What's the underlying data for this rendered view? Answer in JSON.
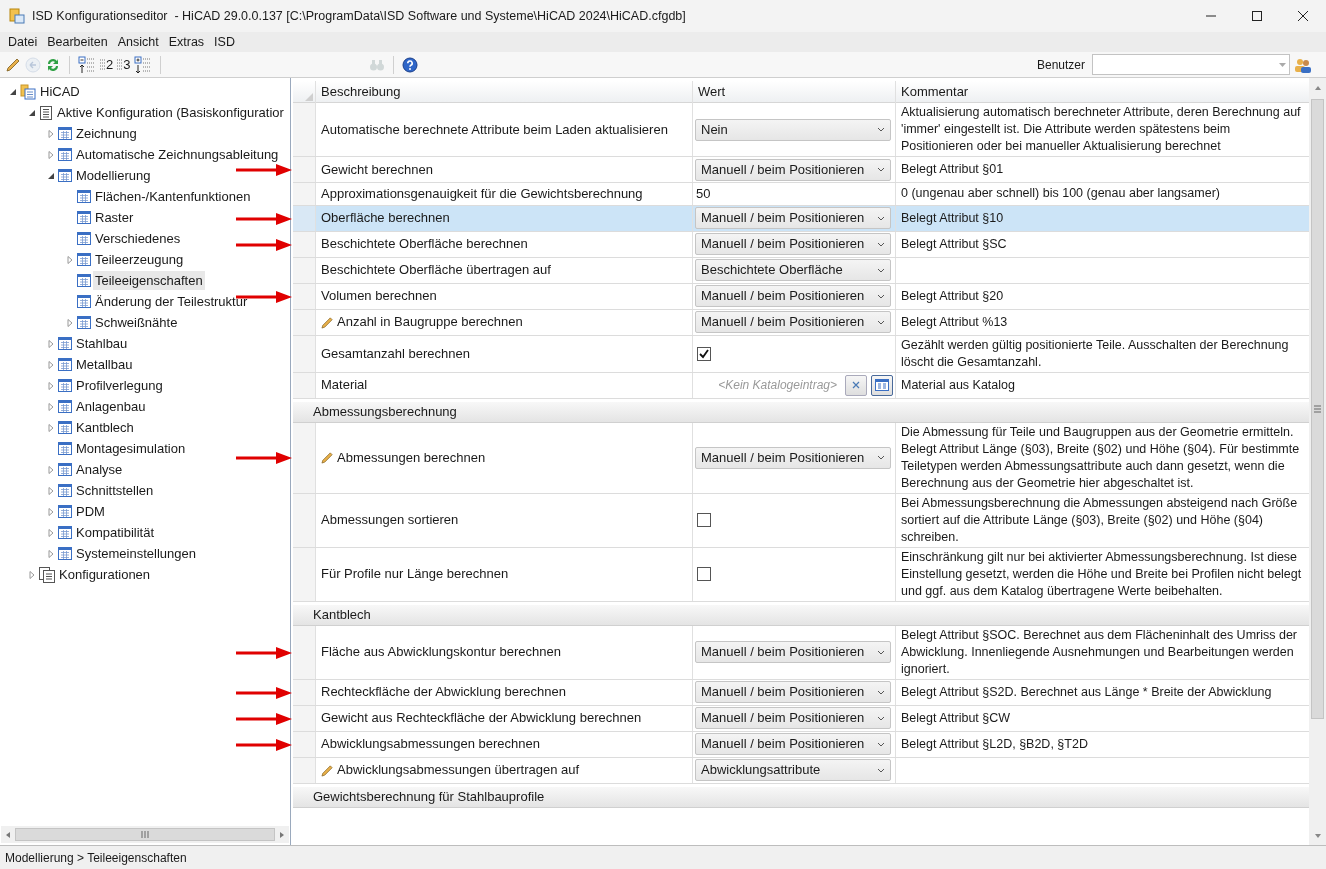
{
  "window": {
    "title": "ISD Konfigurationseditor  - HiCAD 29.0.0.137 [C:\\ProgramData\\ISD Software und Systeme\\HiCAD 2024\\HiCAD.cfgdb]"
  },
  "menu": [
    "Datei",
    "Bearbeiten",
    "Ansicht",
    "Extras",
    "ISD"
  ],
  "toolbar": [
    {
      "kind": "edit",
      "disabled": false
    },
    {
      "kind": "undo",
      "disabled": true
    },
    {
      "kind": "refresh",
      "disabled": false
    },
    {
      "kind": "sep"
    },
    {
      "kind": "level-collapse",
      "disabled": false
    },
    {
      "kind": "level",
      "label": "2",
      "disabled": false
    },
    {
      "kind": "level",
      "label": "3",
      "disabled": false
    },
    {
      "kind": "level-expand",
      "disabled": false
    },
    {
      "kind": "sep"
    },
    {
      "kind": "search",
      "disabled": true
    },
    {
      "kind": "sep"
    },
    {
      "kind": "help",
      "disabled": false
    }
  ],
  "user": {
    "label": "Benutzer"
  },
  "tree": [
    {
      "label": "HiCAD",
      "kind": "root",
      "expandable": true,
      "expanded": true,
      "selected": false,
      "children": [
        {
          "label": "Aktive Konfiguration (Basiskonfiguratior",
          "kind": "config",
          "expandable": true,
          "expanded": true,
          "selected": false,
          "children": [
            {
              "label": "Zeichnung",
              "kind": "section",
              "expandable": true,
              "expanded": false,
              "selected": false
            },
            {
              "label": "Automatische Zeichnungsableitung",
              "kind": "section",
              "expandable": true,
              "expanded": false,
              "selected": false
            },
            {
              "label": "Modellierung",
              "kind": "section",
              "expandable": true,
              "expanded": true,
              "selected": false,
              "children": [
                {
                  "label": "Flächen-/Kantenfunktionen",
                  "kind": "section",
                  "expandable": false,
                  "selected": false
                },
                {
                  "label": "Raster",
                  "kind": "section",
                  "expandable": false,
                  "selected": false
                },
                {
                  "label": "Verschiedenes",
                  "kind": "section",
                  "expandable": false,
                  "selected": false
                },
                {
                  "label": "Teileerzeugung",
                  "kind": "section",
                  "expandable": true,
                  "expanded": false,
                  "selected": false
                },
                {
                  "label": "Teileeigenschaften",
                  "kind": "section",
                  "expandable": false,
                  "selected": true
                },
                {
                  "label": "Änderung der Teilestruktur",
                  "kind": "section",
                  "expandable": false,
                  "selected": false
                },
                {
                  "label": "Schweißnähte",
                  "kind": "section",
                  "expandable": true,
                  "expanded": false,
                  "selected": false
                }
              ]
            },
            {
              "label": "Stahlbau",
              "kind": "section",
              "expandable": true,
              "expanded": false,
              "selected": false
            },
            {
              "label": "Metallbau",
              "kind": "section",
              "expandable": true,
              "expanded": false,
              "selected": false
            },
            {
              "label": "Profilverlegung",
              "kind": "section",
              "expandable": true,
              "expanded": false,
              "selected": false
            },
            {
              "label": "Anlagenbau",
              "kind": "section",
              "expandable": true,
              "expanded": false,
              "selected": false
            },
            {
              "label": "Kantblech",
              "kind": "section",
              "expandable": true,
              "expanded": false,
              "selected": false
            },
            {
              "label": "Montagesimulation",
              "kind": "section",
              "expandable": false,
              "selected": false
            },
            {
              "label": "Analyse",
              "kind": "section",
              "expandable": true,
              "expanded": false,
              "selected": false
            },
            {
              "label": "Schnittstellen",
              "kind": "section",
              "expandable": true,
              "expanded": false,
              "selected": false
            },
            {
              "label": "PDM",
              "kind": "section",
              "expandable": true,
              "expanded": false,
              "selected": false
            },
            {
              "label": "Kompatibilität",
              "kind": "section",
              "expandable": true,
              "expanded": false,
              "selected": false
            },
            {
              "label": "Systemeinstellungen",
              "kind": "section",
              "expandable": true,
              "expanded": false,
              "selected": false
            }
          ]
        },
        {
          "label": "Konfigurationen",
          "kind": "configs",
          "expandable": true,
          "expanded": false,
          "selected": false
        }
      ]
    }
  ],
  "grid": {
    "columns": [
      "Beschreibung",
      "Wert",
      "Kommentar"
    ],
    "rows": [
      {
        "kind": "dropdown",
        "description": "Automatische berechnete Attribute beim Laden aktualisieren",
        "value": "Nein",
        "comment": "Aktualisierung automatisch berechneter Attribute, deren Berechnung auf 'immer' eingestellt ist. Die Attribute werden spätestens beim Positionieren oder bei manueller Aktualisierung berechnet",
        "edited": false,
        "arrow": false,
        "selected": false
      },
      {
        "kind": "dropdown",
        "description": "Gewicht berechnen",
        "value": "Manuell / beim Positionieren",
        "comment": "Belegt Attribut §01",
        "edited": false,
        "arrow": true,
        "selected": false
      },
      {
        "kind": "text",
        "description": "Approximationsgenauigkeit für die Gewichtsberechnung",
        "value": "50",
        "comment": "0 (ungenau aber schnell) bis 100 (genau aber langsamer)",
        "edited": false,
        "arrow": false,
        "selected": false
      },
      {
        "kind": "dropdown",
        "description": "Oberfläche berechnen",
        "value": "Manuell / beim Positionieren",
        "comment": "Belegt Attribut §10",
        "edited": false,
        "arrow": true,
        "selected": true
      },
      {
        "kind": "dropdown",
        "description": "Beschichtete Oberfläche berechnen",
        "value": "Manuell / beim Positionieren",
        "comment": "Belegt Attribut §SC",
        "edited": false,
        "arrow": true,
        "selected": false
      },
      {
        "kind": "dropdown",
        "description": "Beschichtete Oberfläche übertragen auf",
        "value": "Beschichtete Oberfläche",
        "edited": false,
        "arrow": false,
        "selected": false
      },
      {
        "kind": "dropdown",
        "description": "Volumen berechnen",
        "value": "Manuell / beim Positionieren",
        "comment": "Belegt Attribut §20",
        "edited": false,
        "arrow": true,
        "selected": false
      },
      {
        "kind": "dropdown",
        "description": "Anzahl in Baugruppe berechnen",
        "value": "Manuell / beim Positionieren",
        "comment": "Belegt Attribut %13",
        "edited": true,
        "arrow": false,
        "selected": false
      },
      {
        "kind": "checkbox",
        "description": "Gesamtanzahl berechnen",
        "checked": true,
        "comment": "Gezählt werden gültig positionierte Teile. Ausschalten der Berechnung löscht die Gesamtanzahl.",
        "edited": false,
        "arrow": false,
        "selected": false
      },
      {
        "kind": "catalog",
        "description": "Material",
        "placeholder": "<Kein Katalogeintrag>",
        "comment": "Material aus Katalog",
        "edited": false,
        "arrow": false,
        "selected": false
      },
      {
        "kind": "section",
        "description": "Abmessungsberechnung"
      },
      {
        "kind": "dropdown",
        "description": "Abmessungen berechnen",
        "value": "Manuell / beim Positionieren",
        "comment": "Die Abmessung für Teile und Baugruppen aus der Geometrie ermitteln. Belegt Attribut Länge (§03), Breite (§02) und Höhe (§04). Für bestimmte Teiletypen werden Abmessungsattribute auch dann gesetzt, wenn die Berechnung aus der Geometrie hier abgeschaltet ist.",
        "edited": true,
        "arrow": true,
        "selected": false
      },
      {
        "kind": "checkbox",
        "description": "Abmessungen sortieren",
        "checked": false,
        "comment": "Bei Abmessungsberechnung die Abmessungen absteigend nach Größe sortiert auf die Attribute Länge (§03), Breite (§02) und Höhe (§04) schreiben.",
        "edited": false,
        "arrow": false,
        "selected": false
      },
      {
        "kind": "checkbox",
        "description": "Für Profile nur Länge berechnen",
        "checked": false,
        "comment": "Einschränkung gilt nur bei aktivierter Abmessungsberechnung. Ist diese Einstellung gesetzt, werden die Höhe und Breite bei Profilen nicht belegt und ggf. aus dem Katalog übertragene Werte beibehalten.",
        "edited": false,
        "arrow": false,
        "selected": false
      },
      {
        "kind": "section",
        "description": "Kantblech"
      },
      {
        "kind": "dropdown",
        "description": "Fläche aus Abwicklungskontur berechnen",
        "value": "Manuell / beim Positionieren",
        "comment": "Belegt Attribut §SOC. Berechnet aus dem Flächeninhalt des Umriss der Abwicklung. Innenliegende Ausnehmungen und Bearbeitungen werden ignoriert.",
        "edited": false,
        "arrow": true,
        "selected": false
      },
      {
        "kind": "dropdown",
        "description": "Rechteckfläche der Abwicklung berechnen",
        "value": "Manuell / beim Positionieren",
        "comment": "Belegt Attribut §S2D. Berechnet aus Länge * Breite der Abwicklung",
        "edited": false,
        "arrow": true,
        "selected": false
      },
      {
        "kind": "dropdown",
        "description": "Gewicht aus Rechteckfläche der Abwicklung berechnen",
        "value": "Manuell / beim Positionieren",
        "comment": "Belegt Attribut §CW",
        "edited": false,
        "arrow": true,
        "selected": false
      },
      {
        "kind": "dropdown",
        "description": "Abwicklungsabmessungen berechnen",
        "value": "Manuell / beim Positionieren",
        "comment": "Belegt Attribut §L2D, §B2D, §T2D",
        "edited": false,
        "arrow": true,
        "selected": false
      },
      {
        "kind": "dropdown",
        "description": "Abwicklungsabmessungen übertragen auf",
        "value": "Abwicklungsattribute",
        "edited": true,
        "arrow": false,
        "selected": false
      },
      {
        "kind": "section",
        "description": "Gewichtsberechnung für Stahlbauprofile"
      }
    ]
  },
  "status_bar": "Modellierung > Teileeigenschaften"
}
